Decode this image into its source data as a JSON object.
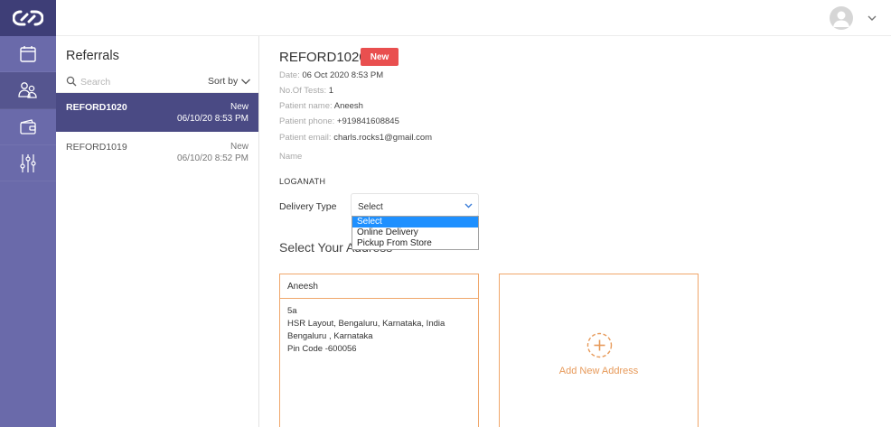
{
  "rail": {
    "items": [
      {
        "name": "calendar-icon"
      },
      {
        "name": "doctor-referral-icon",
        "active": true
      },
      {
        "name": "wallet-icon"
      },
      {
        "name": "settings-sliders-icon"
      }
    ]
  },
  "list": {
    "title": "Referrals",
    "search_placeholder": "Search",
    "sort_label": "Sort by",
    "items": [
      {
        "id": "REFORD1020",
        "status": "New",
        "date": "06/10/20 8:53 PM",
        "selected": true
      },
      {
        "id": "REFORD1019",
        "status": "New",
        "date": "06/10/20 8:52 PM",
        "selected": false
      }
    ]
  },
  "detail": {
    "id": "REFORD1020",
    "badge": "New",
    "date_label": "Date:",
    "date_value": "06 Oct 2020 8:53 PM",
    "tests_label": "No.Of Tests:",
    "tests_value": "1",
    "patient_name_label": "Patient name:",
    "patient_name_value": "Aneesh",
    "patient_phone_label": "Patient phone:",
    "patient_phone_value": "+919841608845",
    "patient_email_label": "Patient email:",
    "patient_email_value": "charls.rocks1@gmail.com",
    "name_label": "Name",
    "name_value": "LOGANATH",
    "delivery_label": "Delivery Type",
    "delivery_selected": "Select",
    "delivery_options": [
      "Select",
      "Online Delivery",
      "Pickup From Store"
    ],
    "address_section_title": "Select Your Address",
    "address": {
      "name": "Aneesh",
      "line1": "5a",
      "line2": "HSR Layout, Bengaluru, Karnataka, India",
      "line3": "Bengaluru , Karnataka",
      "line4": "Pin Code -600056"
    },
    "add_address_label": "Add New Address"
  },
  "colors": {
    "rail": "#6a6aaa",
    "rail_logo": "#3e3e77",
    "selected_row": "#4a4a84",
    "badge": "#e94f4f",
    "card_border": "#f0a66a",
    "add_address": "#e79a5a",
    "dropdown_highlight": "#1e90ff"
  }
}
